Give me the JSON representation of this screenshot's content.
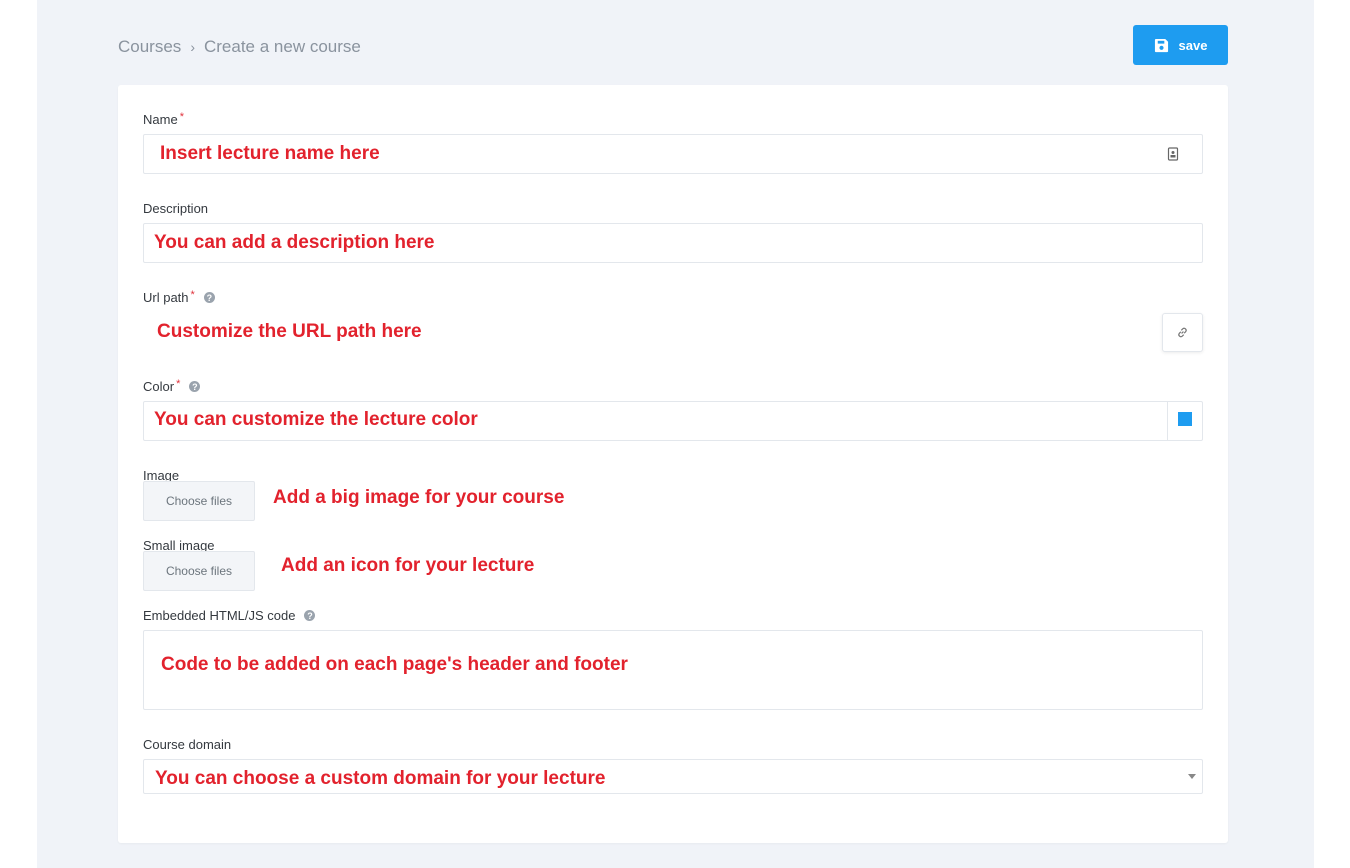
{
  "breadcrumb": {
    "root": "Courses",
    "current": "Create a new course"
  },
  "toolbar": {
    "save_label": "save"
  },
  "form": {
    "name": {
      "label": "Name",
      "required_mark": "*",
      "hint": "Insert lecture name here"
    },
    "description": {
      "label": "Description",
      "hint": "You can add a description here"
    },
    "url_path": {
      "label": "Url path",
      "required_mark": "*",
      "help_mark": "?",
      "hint": "Customize the URL path here"
    },
    "color": {
      "label": "Color",
      "required_mark": "*",
      "help_mark": "?",
      "hint": "You can customize the lecture color",
      "swatch_color": "#1e9cf0"
    },
    "image": {
      "label": "Image",
      "button_label": "Choose files",
      "hint": "Add a big image for your course"
    },
    "small_image": {
      "label": "Small image",
      "button_label": "Choose files",
      "hint": "Add an icon for your lecture"
    },
    "embedded_code": {
      "label": "Embedded HTML/JS code",
      "help_mark": "?",
      "hint": "Code to be added on each page's header and footer"
    },
    "course_domain": {
      "label": "Course domain",
      "hint": "You can choose a custom domain for your lecture"
    }
  },
  "colors": {
    "accent": "#1e9cf0",
    "hint_red": "#e2222d",
    "background": "#f0f3f8"
  }
}
